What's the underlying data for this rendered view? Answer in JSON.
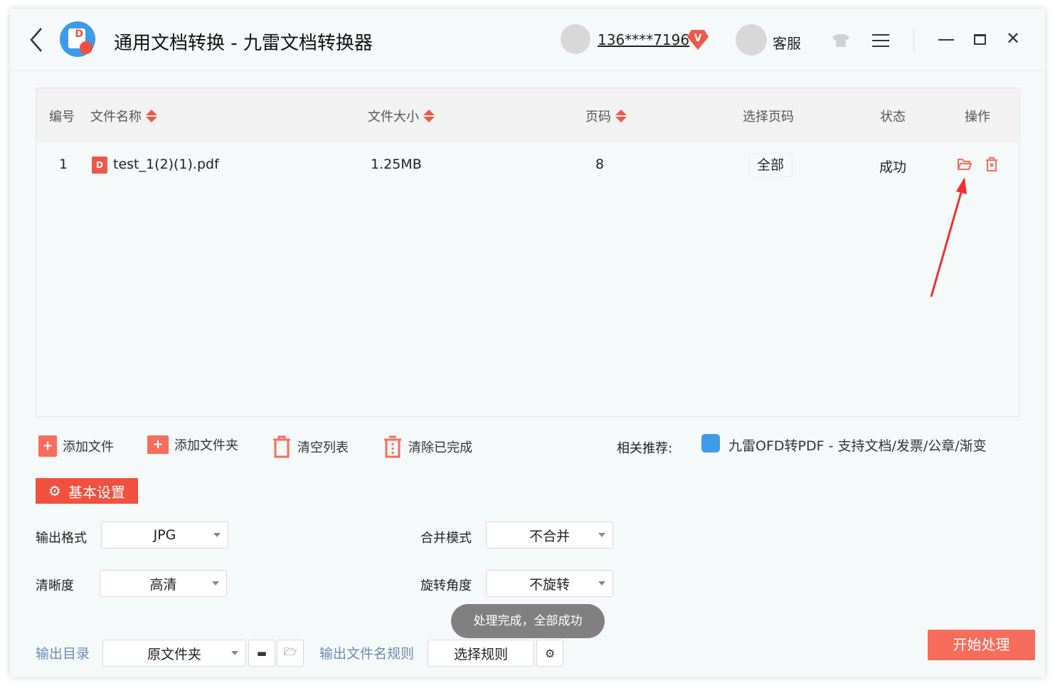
{
  "titlebar": {
    "title": "通用文档转换 - 九雷文档转换器",
    "user": "136****7196",
    "vip_badge": "V",
    "service": "客服"
  },
  "table": {
    "headers": {
      "index": "编号",
      "name": "文件名称",
      "size": "文件大小",
      "pages": "页码",
      "select_pages": "选择页码",
      "status": "状态",
      "action": "操作"
    },
    "rows": [
      {
        "index": "1",
        "file_type": "D",
        "name": "test_1(2)(1).pdf",
        "size": "1.25MB",
        "pages": "8",
        "select_pages": "全部",
        "status": "成功"
      }
    ]
  },
  "toolbar": {
    "add_file": "添加文件",
    "add_folder": "添加文件夹",
    "clear_list": "清空列表",
    "clear_done": "清除已完成",
    "recommend_label": "相关推荐:",
    "recommend_text": "九雷OFD转PDF - 支持文档/发票/公章/渐变"
  },
  "settings": {
    "tab": "基本设置",
    "output_format_label": "输出格式",
    "output_format": "JPG",
    "merge_label": "合并模式",
    "merge": "不合并",
    "clarity_label": "清晰度",
    "clarity": "高清",
    "rotate_label": "旋转角度",
    "rotate": "不旋转",
    "output_dir_label": "输出目录",
    "output_dir": "原文件夹",
    "filename_rule_label": "输出文件名规则",
    "filename_rule": "选择规则"
  },
  "toast": "处理完成，全部成功",
  "start_button": "开始处理",
  "colors": {
    "accent": "#f0503d",
    "start": "#f86c5b"
  }
}
